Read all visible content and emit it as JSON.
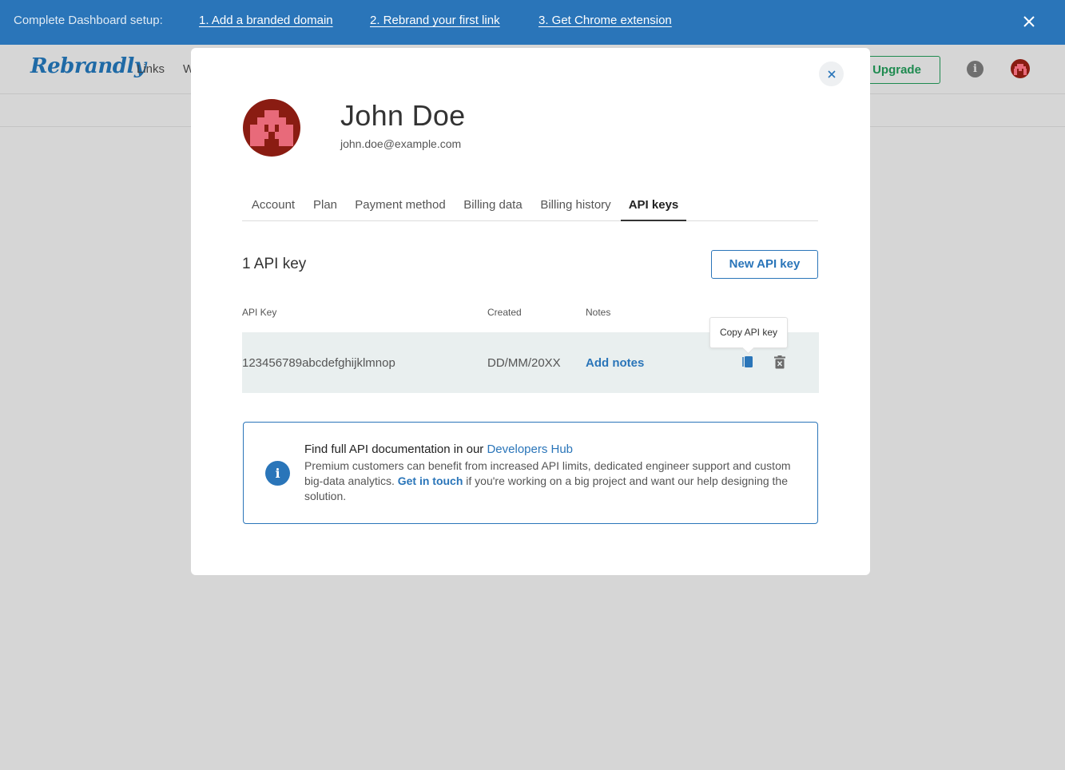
{
  "banner": {
    "prefix": "Complete Dashboard setup:",
    "steps": [
      "1. Add a branded domain",
      "2. Rebrand your first link",
      "3. Get Chrome extension"
    ]
  },
  "app": {
    "logo": "Rebrandly",
    "nav": [
      "Links",
      "W"
    ],
    "upgrade": "Upgrade",
    "info": "i"
  },
  "profile": {
    "name": "John Doe",
    "email": "john.doe@example.com"
  },
  "tabs": [
    "Account",
    "Plan",
    "Payment method",
    "Billing data",
    "Billing history",
    "API keys"
  ],
  "active_tab": "API keys",
  "api": {
    "count_title": "1 API key",
    "new_button": "New API key",
    "columns": [
      "API Key",
      "Created",
      "Notes"
    ],
    "rows": [
      {
        "key": "123456789abcdefghijklmnop",
        "created": "DD/MM/20XX",
        "notes": "Add notes"
      }
    ],
    "tooltip": "Copy API key"
  },
  "infobox": {
    "head_text": "Find full API documentation in our",
    "head_link": "Developers Hub",
    "body_1": "Premium customers can benefit from increased API limits, dedicated engineer support and custom big-data analytics.",
    "body_link": "Get in touch",
    "body_2": "if you're working on a big project and want our help designing the solution."
  },
  "colors": {
    "banner": "#2a75b9",
    "accent": "#2a75b9",
    "upgrade": "#1e8a4f",
    "row_bg": "#e9efef",
    "overlay": "#d6d6d6"
  }
}
